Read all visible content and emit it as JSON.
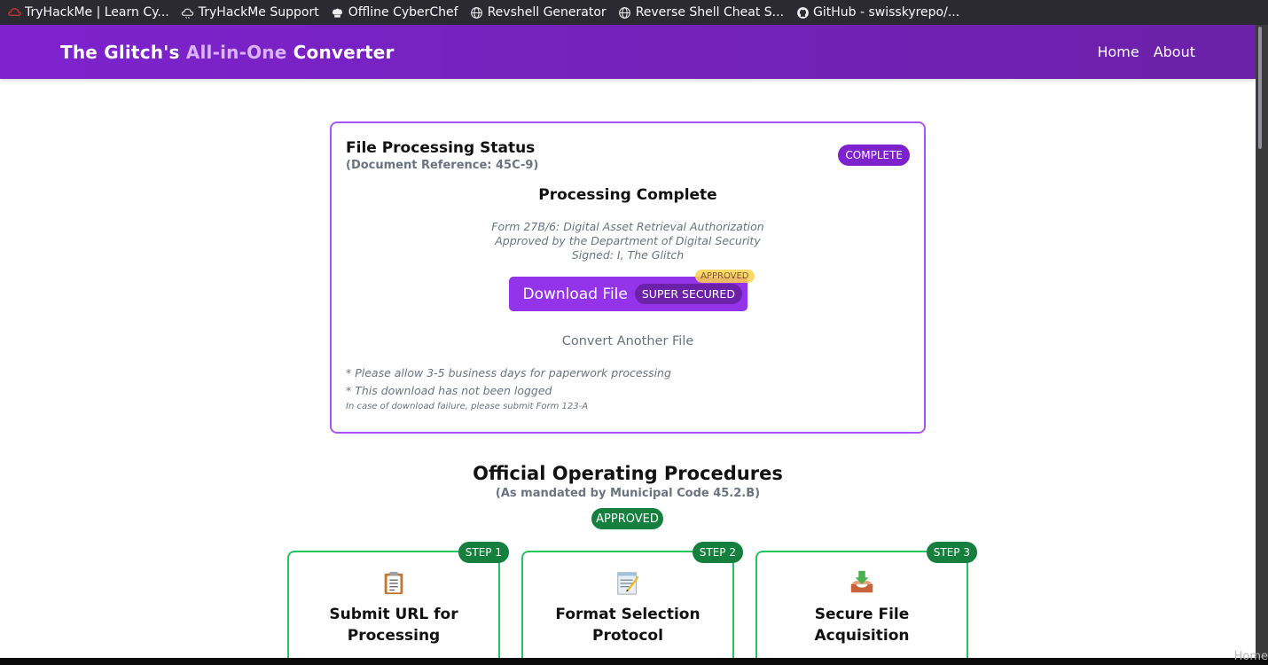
{
  "bookmarks": [
    {
      "icon": "tryhackme-icon",
      "label": "TryHackMe | Learn Cy..."
    },
    {
      "icon": "cloud-icon",
      "label": "TryHackMe Support"
    },
    {
      "icon": "chef-hat-icon",
      "label": "Offline CyberChef"
    },
    {
      "icon": "globe-icon",
      "label": "Revshell Generator"
    },
    {
      "icon": "globe-icon",
      "label": "Reverse Shell Cheat S..."
    },
    {
      "icon": "github-icon",
      "label": "GitHub - swisskyrepo/..."
    }
  ],
  "navbar": {
    "brand_prefix": "The Glitch's ",
    "brand_accent": "All-in-One",
    "brand_suffix": " Converter",
    "links": [
      "Home",
      "About"
    ]
  },
  "status": {
    "title": "File Processing Status",
    "reference": "(Document Reference: 45C-9)",
    "badge": "COMPLETE",
    "heading": "Processing Complete",
    "form_lines": [
      "Form 27B/6: Digital Asset Retrieval Authorization",
      "Approved by the Department of Digital Security",
      "Signed: I, The Glitch"
    ],
    "download_label": "Download File",
    "download_badge": "SUPER SECURED",
    "approved_tag": "APPROVED",
    "convert_another": "Convert Another File",
    "notes": [
      "* Please allow 3-5 business days for paperwork processing",
      "* This download has not been logged"
    ],
    "small_note": "In case of download failure, please submit Form 123-A"
  },
  "procedures": {
    "title": "Official Operating Procedures",
    "subtitle": "(As mandated by Municipal Code 45.2.B)",
    "badge": "APPROVED",
    "steps": [
      {
        "badge": "STEP 1",
        "icon": "clipboard-icon",
        "title": "Submit URL for Processing"
      },
      {
        "badge": "STEP 2",
        "icon": "memo-icon",
        "title": "Format Selection Protocol"
      },
      {
        "badge": "STEP 3",
        "icon": "inbox-download-icon",
        "title": "Secure File Acquisition"
      }
    ]
  },
  "overlay_text": "Home",
  "colors": {
    "nav_purple": "#7e22ce",
    "card_border": "#a855f7",
    "button_purple": "#9333ea",
    "approved_green": "#15803d",
    "step_border": "#22c55e"
  }
}
